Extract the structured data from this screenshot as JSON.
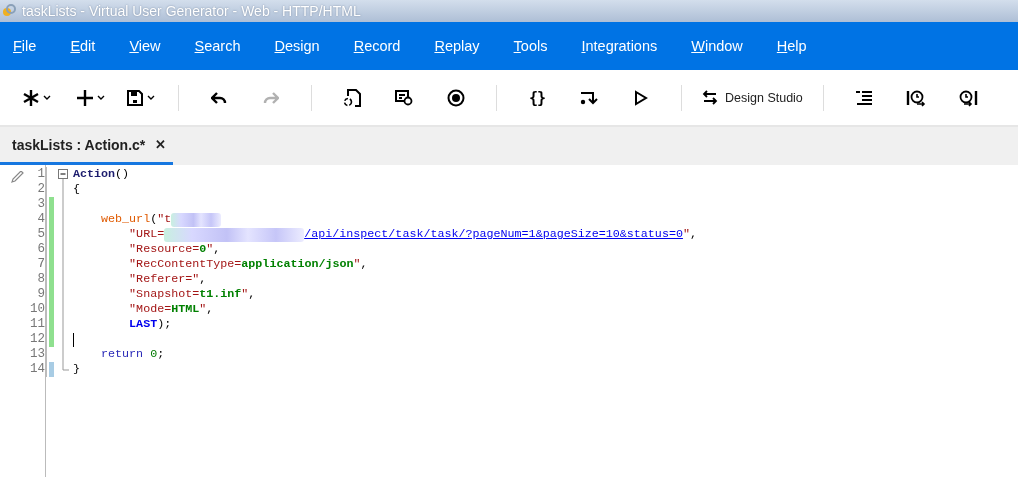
{
  "window": {
    "title": "taskLists - Virtual User Generator - Web - HTTP/HTML"
  },
  "menu": [
    {
      "label": "File"
    },
    {
      "label": "Edit"
    },
    {
      "label": "View"
    },
    {
      "label": "Search"
    },
    {
      "label": "Design"
    },
    {
      "label": "Record"
    },
    {
      "label": "Replay"
    },
    {
      "label": "Tools"
    },
    {
      "label": "Integrations"
    },
    {
      "label": "Window"
    },
    {
      "label": "Help"
    }
  ],
  "toolbar": [
    {
      "kind": "menu-button",
      "disabled": false
    },
    {
      "kind": "menu-button",
      "disabled": false
    },
    {
      "kind": "menu-button",
      "disabled": false
    },
    {
      "kind": "separator"
    },
    {
      "kind": "button",
      "disabled": false
    },
    {
      "kind": "button",
      "disabled": true
    },
    {
      "kind": "separator"
    },
    {
      "kind": "button",
      "disabled": false
    },
    {
      "kind": "button",
      "disabled": false
    },
    {
      "kind": "button",
      "disabled": false
    },
    {
      "kind": "separator"
    },
    {
      "kind": "glyph-button",
      "glyph": "{}",
      "disabled": false
    },
    {
      "kind": "button",
      "disabled": false
    },
    {
      "kind": "button",
      "disabled": false
    },
    {
      "kind": "separator"
    },
    {
      "kind": "text-button",
      "label": "Design Studio",
      "disabled": false
    },
    {
      "kind": "separator"
    },
    {
      "kind": "button",
      "disabled": false
    },
    {
      "kind": "button",
      "disabled": false
    },
    {
      "kind": "button",
      "disabled": false
    }
  ],
  "tabs": [
    {
      "label": "taskLists : Action.c*",
      "close": "✕",
      "selected": true
    }
  ],
  "editor": {
    "lines": [
      {
        "number": "1",
        "changed": false,
        "saved": false,
        "tokens": [
          {
            "kind": "ident",
            "text": "Action"
          },
          {
            "kind": "punct",
            "text": "()"
          }
        ]
      },
      {
        "number": "2",
        "changed": false,
        "saved": false,
        "tokens": [
          {
            "kind": "punct",
            "text": "{"
          }
        ]
      },
      {
        "number": "3",
        "changed": true,
        "saved": false
      },
      {
        "number": "4",
        "changed": true,
        "saved": false,
        "tokens": [
          {
            "kind": "fn",
            "text": "    web_url"
          },
          {
            "kind": "punct",
            "text": "("
          },
          {
            "kind": "str",
            "text": "\"t"
          },
          {
            "kind": "redacted"
          }
        ]
      },
      {
        "number": "5",
        "changed": true,
        "saved": false,
        "tokens": [
          {
            "kind": "str",
            "text": "        \"URL="
          },
          {
            "kind": "redacted"
          },
          {
            "kind": "link",
            "text": "/api/inspect/task/task/?pageNum=1&pageSize=10&status=0"
          },
          {
            "kind": "str",
            "text": "\""
          },
          {
            "kind": "punct",
            "text": ","
          }
        ]
      },
      {
        "number": "6",
        "changed": true,
        "saved": false,
        "tokens": [
          {
            "kind": "str",
            "text": "        \"Resource="
          },
          {
            "kind": "val",
            "text": "0"
          },
          {
            "kind": "str",
            "text": "\""
          },
          {
            "kind": "punct",
            "text": ","
          }
        ]
      },
      {
        "number": "7",
        "changed": true,
        "saved": false,
        "tokens": [
          {
            "kind": "str",
            "text": "        \"RecContentType="
          },
          {
            "kind": "val",
            "text": "application/json"
          },
          {
            "kind": "str",
            "text": "\""
          },
          {
            "kind": "punct",
            "text": ","
          }
        ]
      },
      {
        "number": "8",
        "changed": true,
        "saved": false,
        "tokens": [
          {
            "kind": "str",
            "text": "        \"Referer=\""
          },
          {
            "kind": "punct",
            "text": ","
          }
        ]
      },
      {
        "number": "9",
        "changed": true,
        "saved": false,
        "tokens": [
          {
            "kind": "str",
            "text": "        \"Snapshot="
          },
          {
            "kind": "val",
            "text": "t1.inf"
          },
          {
            "kind": "str",
            "text": "\""
          },
          {
            "kind": "punct",
            "text": ","
          }
        ]
      },
      {
        "number": "10",
        "changed": true,
        "saved": false,
        "tokens": [
          {
            "kind": "str",
            "text": "        \"Mode="
          },
          {
            "kind": "val",
            "text": "HTML"
          },
          {
            "kind": "str",
            "text": "\""
          },
          {
            "kind": "punct",
            "text": ","
          }
        ]
      },
      {
        "number": "11",
        "changed": true,
        "saved": false,
        "tokens": [
          {
            "kind": "kw",
            "text": "        LAST"
          },
          {
            "kind": "punct",
            "text": ");"
          }
        ]
      },
      {
        "number": "12",
        "changed": true,
        "saved": false,
        "cursor": true
      },
      {
        "number": "13",
        "changed": false,
        "saved": false,
        "tokens": [
          {
            "kind": "keyword",
            "text": "    return"
          },
          {
            "kind": "num",
            "text": " 0"
          },
          {
            "kind": "punct",
            "text": ";"
          }
        ]
      },
      {
        "number": "14",
        "changed": false,
        "saved": true,
        "tokens": [
          {
            "kind": "punct",
            "text": "}"
          }
        ]
      }
    ]
  }
}
